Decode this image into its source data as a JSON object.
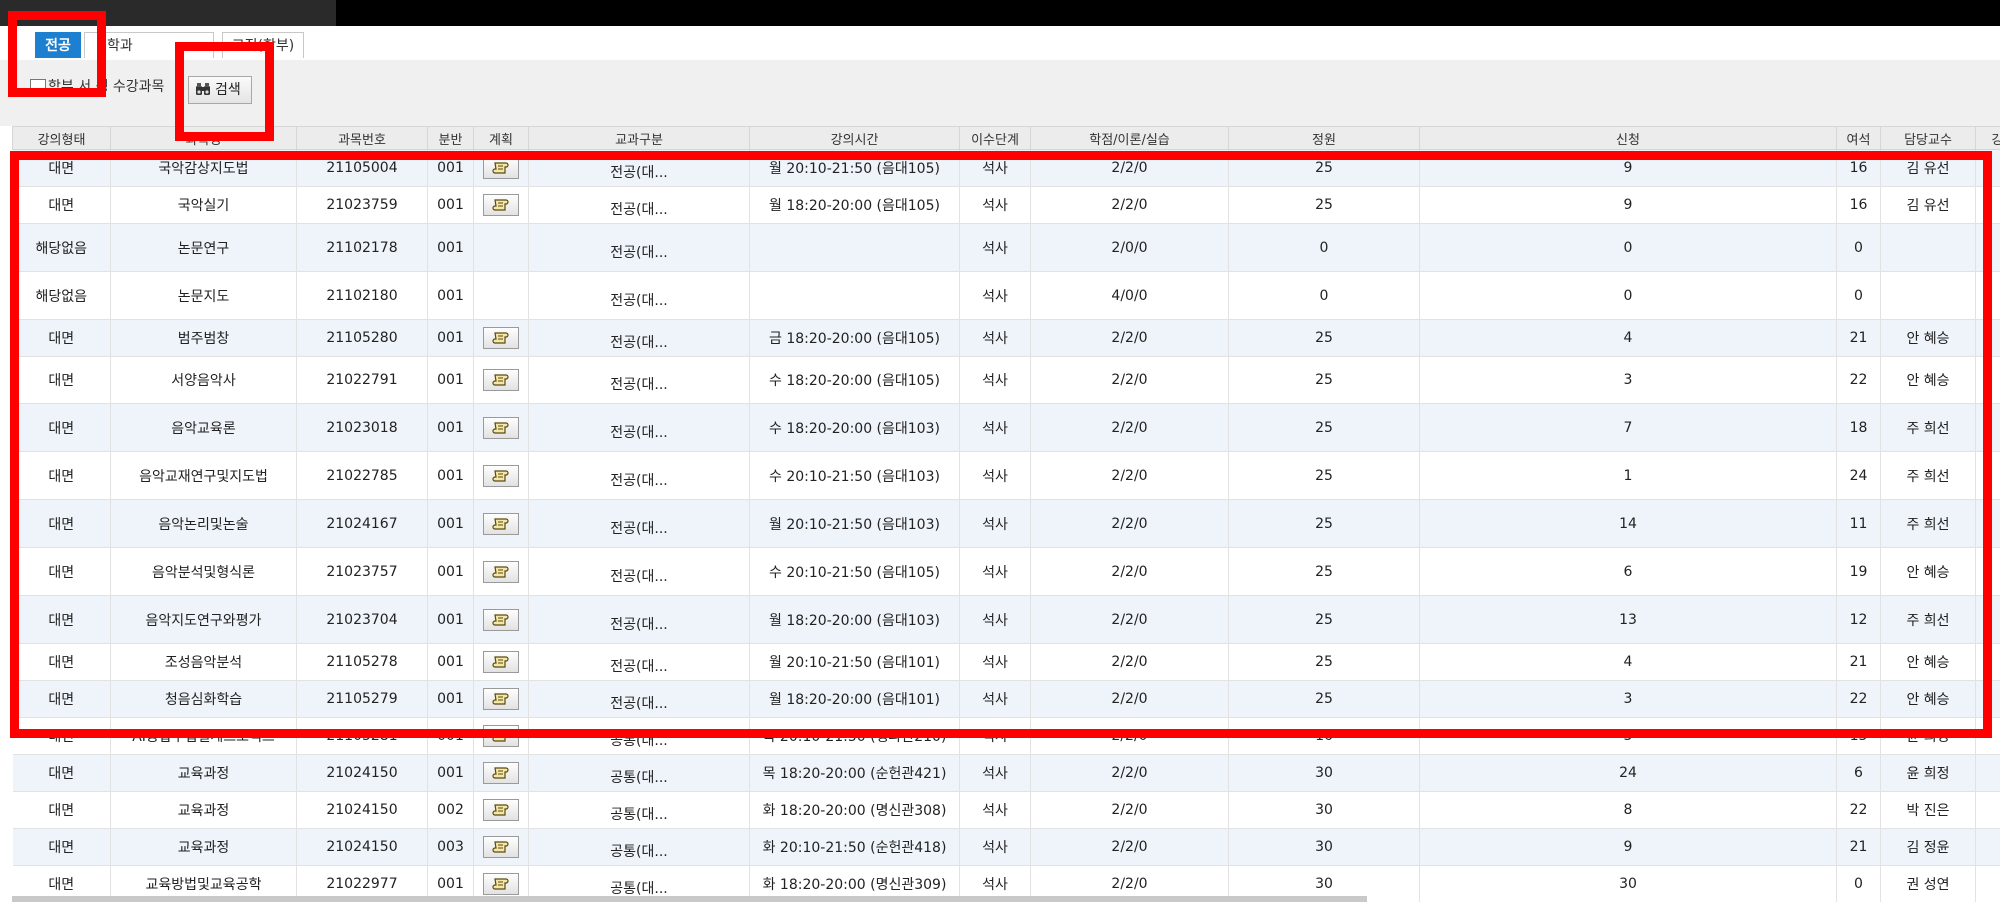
{
  "tabs": [
    "전공",
    "학과",
    "교직(학부)"
  ],
  "toolbar": {
    "checkbox_label": "학부 서 생 수강과목",
    "search_label": "검색"
  },
  "columns": [
    "강의형태",
    "과목명",
    "과목번호",
    "분반",
    "계획",
    "교과구분",
    "강의시간",
    "이수단계",
    "학점/이론/실습",
    "정원",
    "신청",
    "여석",
    "담당교수",
    "강"
  ],
  "rows": [
    {
      "mode": "대면",
      "name": "국악감상지도법",
      "code": "21105004",
      "sec": "001",
      "plan": true,
      "cat": "전공(대...",
      "time": "월 20:10-21:50 (음대105)",
      "level": "석사",
      "credit": "2/2/0",
      "cap": "25",
      "req": "9",
      "left": "16",
      "prof": "김 유선"
    },
    {
      "mode": "대면",
      "name": "국악실기",
      "code": "21023759",
      "sec": "001",
      "plan": true,
      "cat": "전공(대...",
      "time": "월 18:20-20:00 (음대105)",
      "level": "석사",
      "credit": "2/2/0",
      "cap": "25",
      "req": "9",
      "left": "16",
      "prof": "김 유선"
    },
    {
      "mode": "해당없음",
      "name": "논문연구",
      "code": "21102178",
      "sec": "001",
      "plan": false,
      "cat": "전공(대...",
      "time": "",
      "level": "석사",
      "credit": "2/0/0",
      "cap": "0",
      "req": "0",
      "left": "0",
      "prof": ""
    },
    {
      "mode": "해당없음",
      "name": "논문지도",
      "code": "21102180",
      "sec": "001",
      "plan": false,
      "cat": "전공(대...",
      "time": "",
      "level": "석사",
      "credit": "4/0/0",
      "cap": "0",
      "req": "0",
      "left": "0",
      "prof": ""
    },
    {
      "mode": "대면",
      "name": "범주범창",
      "code": "21105280",
      "sec": "001",
      "plan": true,
      "cat": "전공(대...",
      "time": "금 18:20-20:00 (음대105)",
      "level": "석사",
      "credit": "2/2/0",
      "cap": "25",
      "req": "4",
      "left": "21",
      "prof": "안 혜승"
    },
    {
      "mode": "대면",
      "name": "서양음악사",
      "code": "21022791",
      "sec": "001",
      "plan": true,
      "cat": "전공(대...",
      "time": "수 18:20-20:00 (음대105)",
      "level": "석사",
      "credit": "2/2/0",
      "cap": "25",
      "req": "3",
      "left": "22",
      "prof": "안 혜승"
    },
    {
      "mode": "대면",
      "name": "음악교육론",
      "code": "21023018",
      "sec": "001",
      "plan": true,
      "cat": "전공(대...",
      "time": "수 18:20-20:00 (음대103)",
      "level": "석사",
      "credit": "2/2/0",
      "cap": "25",
      "req": "7",
      "left": "18",
      "prof": "주 희선"
    },
    {
      "mode": "대면",
      "name": "음악교재연구및지도법",
      "code": "21022785",
      "sec": "001",
      "plan": true,
      "cat": "전공(대...",
      "time": "수 20:10-21:50 (음대103)",
      "level": "석사",
      "credit": "2/2/0",
      "cap": "25",
      "req": "1",
      "left": "24",
      "prof": "주 희선"
    },
    {
      "mode": "대면",
      "name": "음악논리및논술",
      "code": "21024167",
      "sec": "001",
      "plan": true,
      "cat": "전공(대...",
      "time": "월 20:10-21:50 (음대103)",
      "level": "석사",
      "credit": "2/2/0",
      "cap": "25",
      "req": "14",
      "left": "11",
      "prof": "주 희선"
    },
    {
      "mode": "대면",
      "name": "음악분석및형식론",
      "code": "21023757",
      "sec": "001",
      "plan": true,
      "cat": "전공(대...",
      "time": "수 20:10-21:50 (음대105)",
      "level": "석사",
      "credit": "2/2/0",
      "cap": "25",
      "req": "6",
      "left": "19",
      "prof": "안 혜승"
    },
    {
      "mode": "대면",
      "name": "음악지도연구와평가",
      "code": "21023704",
      "sec": "001",
      "plan": true,
      "cat": "전공(대...",
      "time": "월 18:20-20:00 (음대103)",
      "level": "석사",
      "credit": "2/2/0",
      "cap": "25",
      "req": "13",
      "left": "12",
      "prof": "주 희선"
    },
    {
      "mode": "대면",
      "name": "조성음악분석",
      "code": "21105278",
      "sec": "001",
      "plan": true,
      "cat": "전공(대...",
      "time": "월 20:10-21:50 (음대101)",
      "level": "석사",
      "credit": "2/2/0",
      "cap": "25",
      "req": "4",
      "left": "21",
      "prof": "안 혜승"
    },
    {
      "mode": "대면",
      "name": "청음심화학습",
      "code": "21105279",
      "sec": "001",
      "plan": true,
      "cat": "전공(대...",
      "time": "월 18:20-20:00 (음대101)",
      "level": "석사",
      "credit": "2/2/0",
      "cap": "25",
      "req": "3",
      "left": "22",
      "prof": "안 혜승"
    },
    {
      "mode": "대면",
      "name": "AI융합수업설계프로젝트",
      "code": "21105281",
      "sec": "001",
      "plan": true,
      "cat": "공통(대...",
      "time": "목 20:10-21:50 (행파관210)",
      "level": "석사",
      "credit": "2/2/0",
      "cap": "16",
      "req": "3",
      "left": "13",
      "prof": "윤 희정"
    },
    {
      "mode": "대면",
      "name": "교육과정",
      "code": "21024150",
      "sec": "001",
      "plan": true,
      "cat": "공통(대...",
      "time": "목 18:20-20:00 (순헌관421)",
      "level": "석사",
      "credit": "2/2/0",
      "cap": "30",
      "req": "24",
      "left": "6",
      "prof": "윤 희정"
    },
    {
      "mode": "대면",
      "name": "교육과정",
      "code": "21024150",
      "sec": "002",
      "plan": true,
      "cat": "공통(대...",
      "time": "화 18:20-20:00 (명신관308)",
      "level": "석사",
      "credit": "2/2/0",
      "cap": "30",
      "req": "8",
      "left": "22",
      "prof": "박 진은"
    },
    {
      "mode": "대면",
      "name": "교육과정",
      "code": "21024150",
      "sec": "003",
      "plan": true,
      "cat": "공통(대...",
      "time": "화 20:10-21:50 (순헌관418)",
      "level": "석사",
      "credit": "2/2/0",
      "cap": "30",
      "req": "9",
      "left": "21",
      "prof": "김 정윤"
    },
    {
      "mode": "대면",
      "name": "교육방법및교육공학",
      "code": "21022977",
      "sec": "001",
      "plan": true,
      "cat": "공통(대...",
      "time": "화 18:20-20:00 (명신관309)",
      "level": "석사",
      "credit": "2/2/0",
      "cap": "30",
      "req": "30",
      "left": "0",
      "prof": "권 성연"
    }
  ]
}
